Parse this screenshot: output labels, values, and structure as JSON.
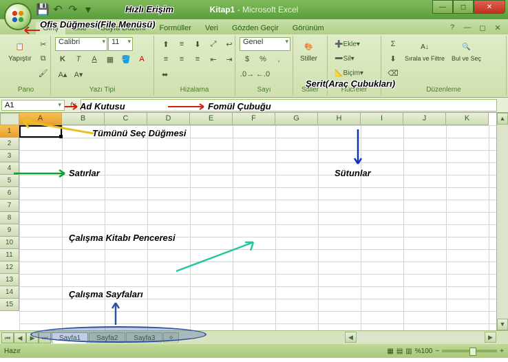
{
  "window": {
    "title_doc": "Kitap1",
    "title_app": "Microsoft Excel"
  },
  "tabs": {
    "home": "Giriş",
    "insert": "Ekle",
    "layout": "Sayfa Düzeni",
    "formulas": "Formüller",
    "data": "Veri",
    "review": "Gözden Geçir",
    "view": "Görünüm"
  },
  "ribbon": {
    "clipboard": {
      "label": "Pano",
      "paste": "Yapıştır"
    },
    "font": {
      "label": "Yazı Tipi",
      "name": "Calibri",
      "size": "11"
    },
    "alignment": {
      "label": "Hizalama"
    },
    "number": {
      "label": "Sayı",
      "format": "Genel"
    },
    "styles": {
      "label": "Stiller",
      "btn": "Stiller"
    },
    "cells": {
      "label": "Hücreler",
      "insert": "Ekle",
      "delete": "Sil",
      "format": "Biçim"
    },
    "editing": {
      "label": "Düzenleme",
      "sort": "Sırala ve Filtre",
      "find": "Bul ve Seç"
    }
  },
  "formulabar": {
    "namebox": "A1",
    "fx": "fx"
  },
  "columns": [
    "A",
    "B",
    "C",
    "D",
    "E",
    "F",
    "G",
    "H",
    "I",
    "J",
    "K"
  ],
  "rows": [
    "1",
    "2",
    "3",
    "4",
    "5",
    "6",
    "7",
    "8",
    "9",
    "10",
    "11",
    "12",
    "13",
    "14",
    "15"
  ],
  "sheets": {
    "s1": "Sayfa1",
    "s2": "Sayfa2",
    "s3": "Sayfa3"
  },
  "status": {
    "ready": "Hazır",
    "zoom": "%100"
  },
  "annotations": {
    "qat": "Hızlı Erişim",
    "office": "Ofis Düğmesi(File Menüsü)",
    "namebox": "Ad Kutusu",
    "formula": "Fomül Çubuğu",
    "selectall": "Tümünü Seç Düğmesi",
    "rows": "Satırlar",
    "cols": "Sütunlar",
    "ribbon": "Şerit(Araç Çubukları)",
    "workbook": "Çalışma Kitabı Penceresi",
    "sheets": "Çalışma Sayfaları"
  }
}
